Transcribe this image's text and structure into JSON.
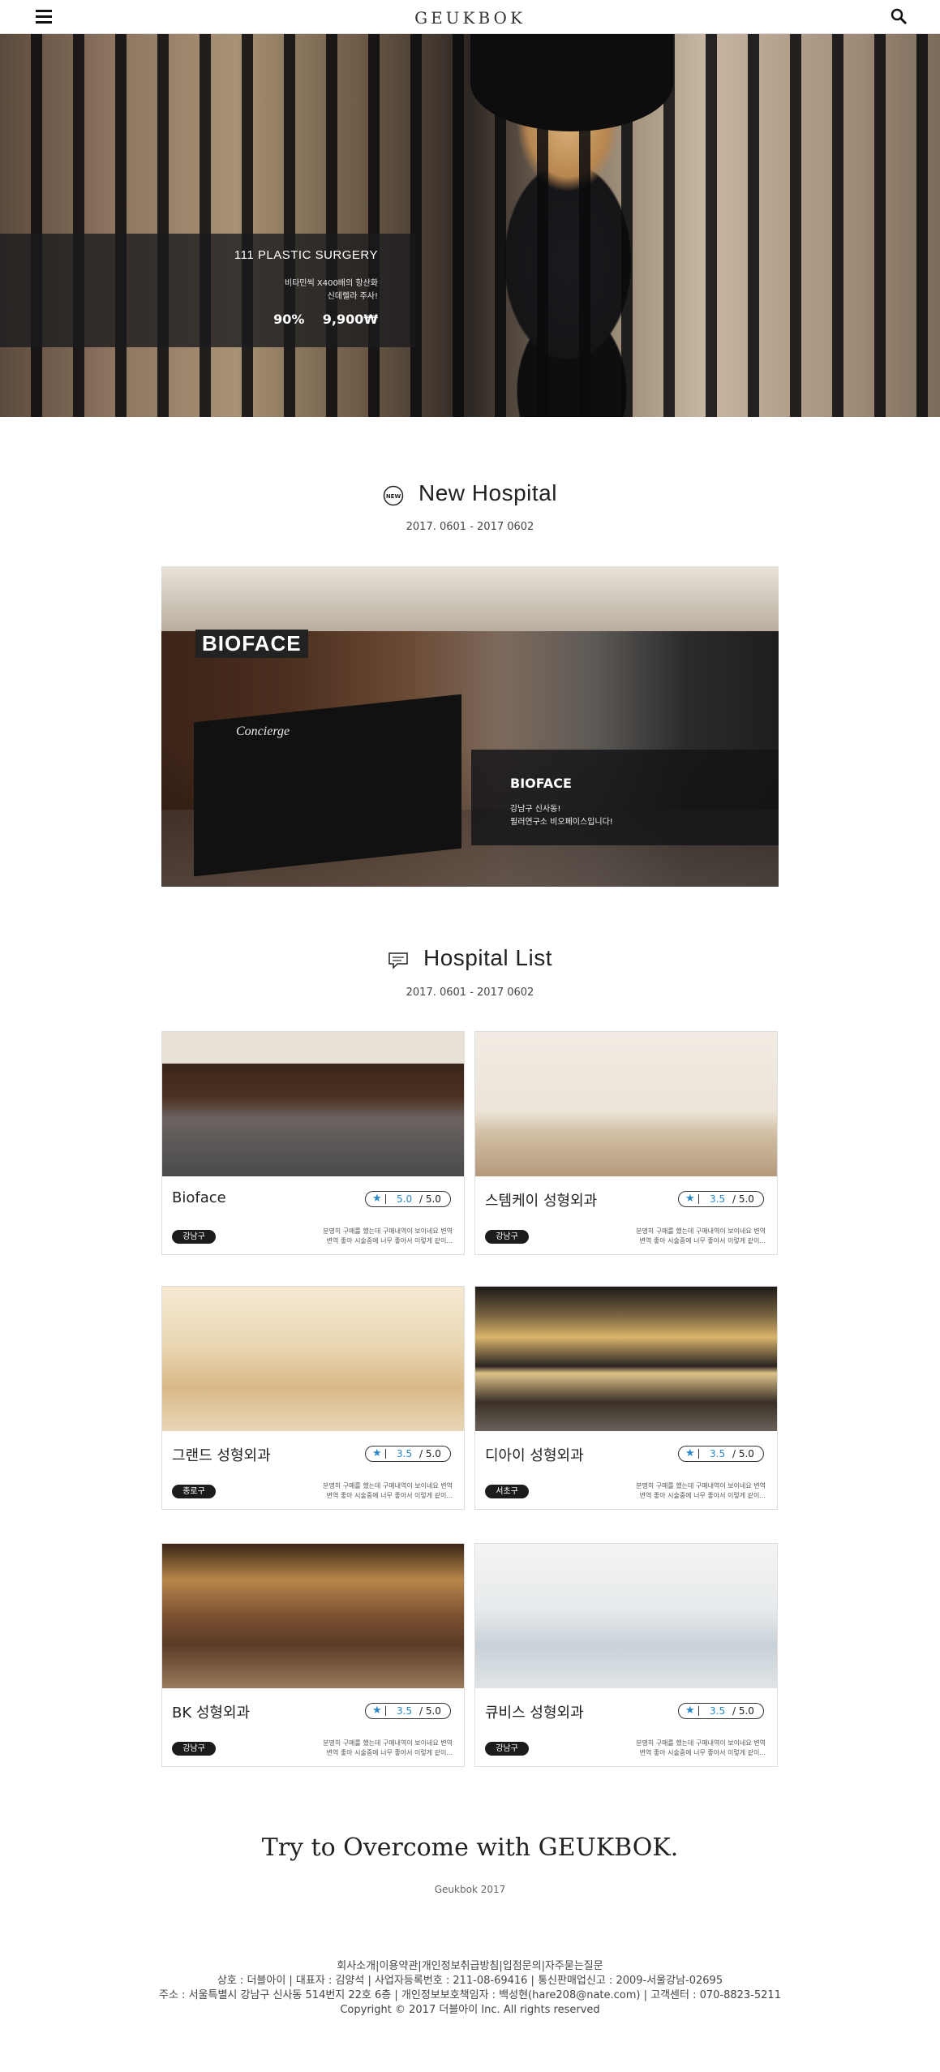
{
  "header": {
    "logo": "GEUKBOK"
  },
  "hero": {
    "title": "111 PLASTIC SURGERY",
    "desc_line1": "비타민씩 X400배의 항산화",
    "desc_line2": "신데렐라 주사!",
    "discount": "90%",
    "price": "9,900₩"
  },
  "new_hospital": {
    "title": "New Hospital",
    "date": "2017. 0601 - 2017 0602",
    "feature": {
      "sign": "BIOFACE",
      "sign_sub": "Concierge",
      "name": "BIOFACE",
      "desc_line1": "강남구 신사동!",
      "desc_line2": "필러연구소 비오페이스입니다!"
    }
  },
  "hospital_list": {
    "title": "Hospital List",
    "date": "2017. 0601 - 2017 0602",
    "rating_max": "/ 5.0",
    "items": [
      {
        "name": "Bioface",
        "rating": "5.0",
        "district": "강남구",
        "desc1": "분명히 구매를 했는데 구매내역이 보이네요 변역",
        "desc2": "변역 좋아 시술중에 너무 좋아서 이렇게 같이..."
      },
      {
        "name": "스템케이 성형외과",
        "rating": "3.5",
        "district": "강남구",
        "desc1": "분명히 구매를 했는데 구매내역이 보이네요 변역",
        "desc2": "변역 좋아 시술중에 너무 좋아서 이렇게 같이..."
      },
      {
        "name": "그랜드 성형외과",
        "rating": "3.5",
        "district": "종로구",
        "desc1": "분명히 구매를 했는데 구매내역이 보이네요 변역",
        "desc2": "변역 좋아 시술중에 너무 좋아서 이렇게 같이..."
      },
      {
        "name": "디아이 성형외과",
        "rating": "3.5",
        "district": "서초구",
        "desc1": "분명히 구매를 했는데 구매내역이 보이네요 변역",
        "desc2": "변역 좋아 시술중에 너무 좋아서 이렇게 같이..."
      },
      {
        "name": "BK 성형외과",
        "rating": "3.5",
        "district": "강남구",
        "desc1": "분명히 구매를 했는데 구매내역이 보이네요 변역",
        "desc2": "변역 좋아 시술중에 너무 좋아서 이렇게 같이..."
      },
      {
        "name": "큐비스 성형외과",
        "rating": "3.5",
        "district": "강남구",
        "desc1": "분명히 구매를 했는데 구매내역이 보이네요 변역",
        "desc2": "변역 좋아 시술중에 너무 좋아서 이렇게 같이..."
      }
    ]
  },
  "tagline": "Try to Overcome with GEUKBOK.",
  "tagline_sub": "Geukbok 2017",
  "footer": {
    "links": "회사소개|이용약관|개인정보취급방침|입점문의|자주묻는질문",
    "line1": "상호 : 더블아이 | 대표자 : 김양석 | 사업자등록번호 : 211-08-69416 | 통신판매업신고 : 2009-서울강남-02695",
    "line2": "주소 : 서울특별시 강남구 신사동 514번지 22호 6층 | 개인정보보호책임자 : 백성현(hare208@nate.com) | 고객센터 : 070-8823-5211",
    "copyright": "Copyright © 2017 더블아이 Inc. All rights reserved"
  }
}
